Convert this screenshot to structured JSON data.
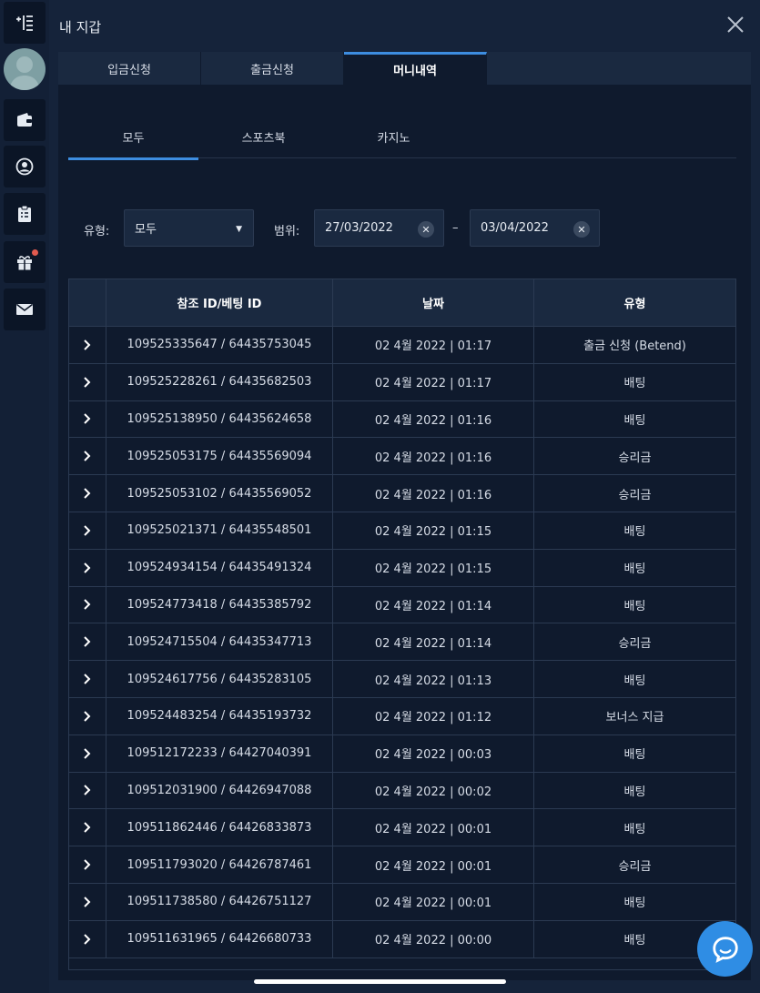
{
  "window": {
    "title": "내 지갑"
  },
  "tabs": [
    {
      "label": "입금신청",
      "active": false
    },
    {
      "label": "출금신청",
      "active": false
    },
    {
      "label": "머니내역",
      "active": true
    }
  ],
  "subtabs": [
    {
      "label": "모두",
      "active": true
    },
    {
      "label": "스포츠북",
      "active": false
    },
    {
      "label": "카지노",
      "active": false
    }
  ],
  "filters": {
    "type_label": "유형:",
    "type_value": "모두",
    "range_label": "범위:",
    "date_from": "27/03/2022",
    "date_to": "03/04/2022",
    "separator": "–"
  },
  "table": {
    "headers": [
      "",
      "참조 ID/베팅 ID",
      "날짜",
      "유형"
    ],
    "rows": [
      {
        "ref": "109525335647 / 64435753045",
        "date": "02 4월 2022 | 01:17",
        "type": "출금 신청 (Betend)"
      },
      {
        "ref": "109525228261 / 64435682503",
        "date": "02 4월 2022 | 01:17",
        "type": "배팅"
      },
      {
        "ref": "109525138950 / 64435624658",
        "date": "02 4월 2022 | 01:16",
        "type": "배팅"
      },
      {
        "ref": "109525053175 / 64435569094",
        "date": "02 4월 2022 | 01:16",
        "type": "승리금"
      },
      {
        "ref": "109525053102 / 64435569052",
        "date": "02 4월 2022 | 01:16",
        "type": "승리금"
      },
      {
        "ref": "109525021371 / 64435548501",
        "date": "02 4월 2022 | 01:15",
        "type": "배팅"
      },
      {
        "ref": "109524934154 / 64435491324",
        "date": "02 4월 2022 | 01:15",
        "type": "배팅"
      },
      {
        "ref": "109524773418 / 64435385792",
        "date": "02 4월 2022 | 01:14",
        "type": "배팅"
      },
      {
        "ref": "109524715504 / 64435347713",
        "date": "02 4월 2022 | 01:14",
        "type": "승리금"
      },
      {
        "ref": "109524617756 / 64435283105",
        "date": "02 4월 2022 | 01:13",
        "type": "배팅"
      },
      {
        "ref": "109524483254 / 64435193732",
        "date": "02 4월 2022 | 01:12",
        "type": "보너스 지급"
      },
      {
        "ref": "109512172233 / 64427040391",
        "date": "02 4월 2022 | 00:03",
        "type": "배팅"
      },
      {
        "ref": "109512031900 / 64426947088",
        "date": "02 4월 2022 | 00:02",
        "type": "배팅"
      },
      {
        "ref": "109511862446 / 64426833873",
        "date": "02 4월 2022 | 00:01",
        "type": "배팅"
      },
      {
        "ref": "109511793020 / 64426787461",
        "date": "02 4월 2022 | 00:01",
        "type": "승리금"
      },
      {
        "ref": "109511738580 / 64426751127",
        "date": "02 4월 2022 | 00:01",
        "type": "배팅"
      },
      {
        "ref": "109511631965 / 64426680733",
        "date": "02 4월 2022 | 00:00",
        "type": "배팅"
      }
    ]
  },
  "colors": {
    "accent": "#3d8de0",
    "chat": "#2f8de4",
    "notification": "#e05a4f"
  }
}
